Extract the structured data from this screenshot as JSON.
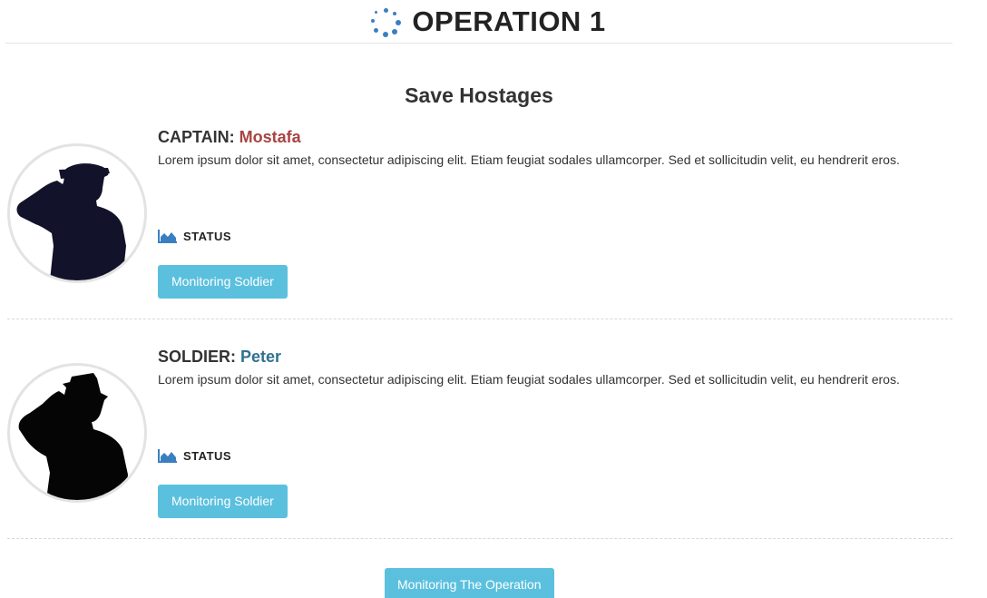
{
  "header": {
    "title": "OPERATION 1",
    "icon": "spinner-icon",
    "icon_color": "#3a7fc0"
  },
  "section": {
    "title": "Save Hostages"
  },
  "members": [
    {
      "role": "CAPTAIN:",
      "name": "Mostafa",
      "name_color": "#a94442",
      "description": "Lorem ipsum dolor sit amet, consectetur adipiscing elit. Etiam feugiat sodales ullamcorper. Sed et sollicitudin velit, eu hendrerit eros.",
      "status_label": "STATUS",
      "status_icon": "area-chart-icon",
      "button_label": "Monitoring Soldier",
      "avatar_icon": "saluting-officer-silhouette-icon"
    },
    {
      "role": "SOLDIER:",
      "name": "Peter",
      "name_color": "#31708f",
      "description": "Lorem ipsum dolor sit amet, consectetur adipiscing elit. Etiam feugiat sodales ullamcorper. Sed et sollicitudin velit, eu hendrerit eros.",
      "status_label": "STATUS",
      "status_icon": "area-chart-icon",
      "button_label": "Monitoring Soldier",
      "avatar_icon": "saluting-soldier-silhouette-icon"
    }
  ],
  "footer": {
    "button_label": "Monitoring The Operation"
  },
  "colors": {
    "button_bg": "#5bc0de",
    "button_text": "#ffffff",
    "status_icon": "#3a7fc0"
  }
}
